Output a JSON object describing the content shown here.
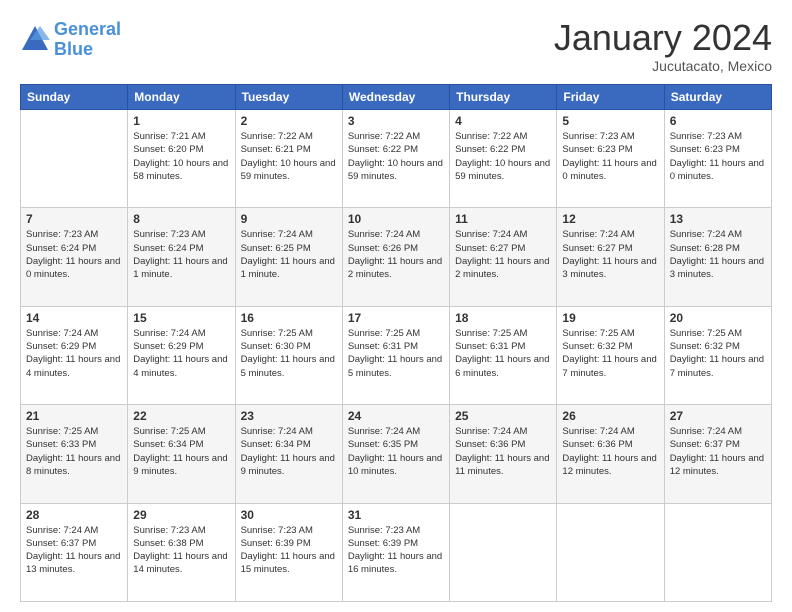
{
  "logo": {
    "line1": "General",
    "line2": "Blue"
  },
  "header": {
    "month": "January 2024",
    "location": "Jucutacato, Mexico"
  },
  "weekdays": [
    "Sunday",
    "Monday",
    "Tuesday",
    "Wednesday",
    "Thursday",
    "Friday",
    "Saturday"
  ],
  "weeks": [
    [
      {
        "day": "",
        "sunrise": "",
        "sunset": "",
        "daylight": ""
      },
      {
        "day": "1",
        "sunrise": "7:21 AM",
        "sunset": "6:20 PM",
        "daylight": "10 hours and 58 minutes."
      },
      {
        "day": "2",
        "sunrise": "7:22 AM",
        "sunset": "6:21 PM",
        "daylight": "10 hours and 59 minutes."
      },
      {
        "day": "3",
        "sunrise": "7:22 AM",
        "sunset": "6:22 PM",
        "daylight": "10 hours and 59 minutes."
      },
      {
        "day": "4",
        "sunrise": "7:22 AM",
        "sunset": "6:22 PM",
        "daylight": "10 hours and 59 minutes."
      },
      {
        "day": "5",
        "sunrise": "7:23 AM",
        "sunset": "6:23 PM",
        "daylight": "11 hours and 0 minutes."
      },
      {
        "day": "6",
        "sunrise": "7:23 AM",
        "sunset": "6:23 PM",
        "daylight": "11 hours and 0 minutes."
      }
    ],
    [
      {
        "day": "7",
        "sunrise": "7:23 AM",
        "sunset": "6:24 PM",
        "daylight": "11 hours and 0 minutes."
      },
      {
        "day": "8",
        "sunrise": "7:23 AM",
        "sunset": "6:24 PM",
        "daylight": "11 hours and 1 minute."
      },
      {
        "day": "9",
        "sunrise": "7:24 AM",
        "sunset": "6:25 PM",
        "daylight": "11 hours and 1 minute."
      },
      {
        "day": "10",
        "sunrise": "7:24 AM",
        "sunset": "6:26 PM",
        "daylight": "11 hours and 2 minutes."
      },
      {
        "day": "11",
        "sunrise": "7:24 AM",
        "sunset": "6:27 PM",
        "daylight": "11 hours and 2 minutes."
      },
      {
        "day": "12",
        "sunrise": "7:24 AM",
        "sunset": "6:27 PM",
        "daylight": "11 hours and 3 minutes."
      },
      {
        "day": "13",
        "sunrise": "7:24 AM",
        "sunset": "6:28 PM",
        "daylight": "11 hours and 3 minutes."
      }
    ],
    [
      {
        "day": "14",
        "sunrise": "7:24 AM",
        "sunset": "6:29 PM",
        "daylight": "11 hours and 4 minutes."
      },
      {
        "day": "15",
        "sunrise": "7:24 AM",
        "sunset": "6:29 PM",
        "daylight": "11 hours and 4 minutes."
      },
      {
        "day": "16",
        "sunrise": "7:25 AM",
        "sunset": "6:30 PM",
        "daylight": "11 hours and 5 minutes."
      },
      {
        "day": "17",
        "sunrise": "7:25 AM",
        "sunset": "6:31 PM",
        "daylight": "11 hours and 5 minutes."
      },
      {
        "day": "18",
        "sunrise": "7:25 AM",
        "sunset": "6:31 PM",
        "daylight": "11 hours and 6 minutes."
      },
      {
        "day": "19",
        "sunrise": "7:25 AM",
        "sunset": "6:32 PM",
        "daylight": "11 hours and 7 minutes."
      },
      {
        "day": "20",
        "sunrise": "7:25 AM",
        "sunset": "6:32 PM",
        "daylight": "11 hours and 7 minutes."
      }
    ],
    [
      {
        "day": "21",
        "sunrise": "7:25 AM",
        "sunset": "6:33 PM",
        "daylight": "11 hours and 8 minutes."
      },
      {
        "day": "22",
        "sunrise": "7:25 AM",
        "sunset": "6:34 PM",
        "daylight": "11 hours and 9 minutes."
      },
      {
        "day": "23",
        "sunrise": "7:24 AM",
        "sunset": "6:34 PM",
        "daylight": "11 hours and 9 minutes."
      },
      {
        "day": "24",
        "sunrise": "7:24 AM",
        "sunset": "6:35 PM",
        "daylight": "11 hours and 10 minutes."
      },
      {
        "day": "25",
        "sunrise": "7:24 AM",
        "sunset": "6:36 PM",
        "daylight": "11 hours and 11 minutes."
      },
      {
        "day": "26",
        "sunrise": "7:24 AM",
        "sunset": "6:36 PM",
        "daylight": "11 hours and 12 minutes."
      },
      {
        "day": "27",
        "sunrise": "7:24 AM",
        "sunset": "6:37 PM",
        "daylight": "11 hours and 12 minutes."
      }
    ],
    [
      {
        "day": "28",
        "sunrise": "7:24 AM",
        "sunset": "6:37 PM",
        "daylight": "11 hours and 13 minutes."
      },
      {
        "day": "29",
        "sunrise": "7:23 AM",
        "sunset": "6:38 PM",
        "daylight": "11 hours and 14 minutes."
      },
      {
        "day": "30",
        "sunrise": "7:23 AM",
        "sunset": "6:39 PM",
        "daylight": "11 hours and 15 minutes."
      },
      {
        "day": "31",
        "sunrise": "7:23 AM",
        "sunset": "6:39 PM",
        "daylight": "11 hours and 16 minutes."
      },
      {
        "day": "",
        "sunrise": "",
        "sunset": "",
        "daylight": ""
      },
      {
        "day": "",
        "sunrise": "",
        "sunset": "",
        "daylight": ""
      },
      {
        "day": "",
        "sunrise": "",
        "sunset": "",
        "daylight": ""
      }
    ]
  ]
}
